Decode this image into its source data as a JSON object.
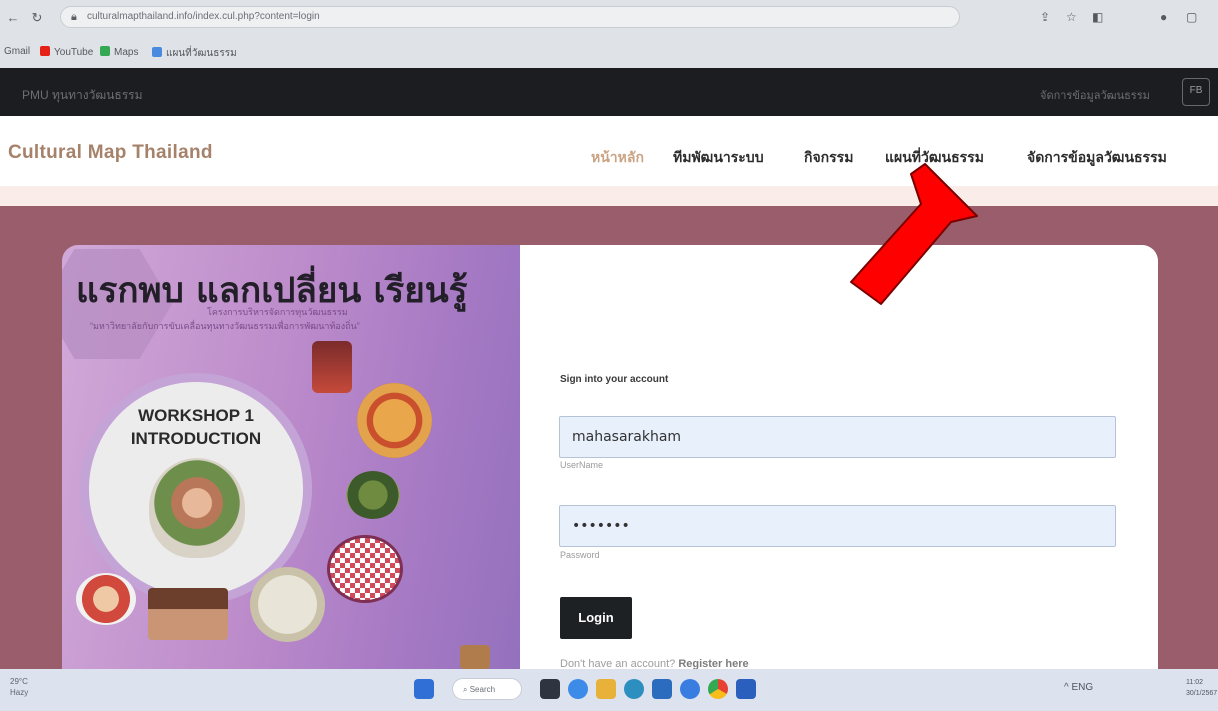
{
  "browser": {
    "url": "culturalmapthailand.info/index.cul.php?content=login",
    "bookmarks": [
      {
        "label": "Gmail",
        "color": "#4285f4"
      },
      {
        "label": "YouTube",
        "color": "#e62117"
      },
      {
        "label": "Maps",
        "color": "#34a853"
      },
      {
        "label": "แผนที่วัฒนธรรม",
        "color": "#4a8be0"
      }
    ],
    "icon_names": [
      "back-icon",
      "reload-icon",
      "lock-icon",
      "share-icon",
      "star-icon",
      "extensions-icon",
      "profile-icon",
      "menu-icon"
    ]
  },
  "sitebar": {
    "left_text": "PMU ทุนทางวัฒนธรรม",
    "right_text": "จัดการข้อมูลวัฒนธรรม",
    "fb_label": "FB"
  },
  "header": {
    "brand": "Cultural Map Thailand",
    "menu": [
      {
        "label": "หน้าหลัก",
        "active": true
      },
      {
        "label": "ทีมพัฒนาระบบ",
        "active": false
      },
      {
        "label": "กิจกรรม",
        "active": false
      },
      {
        "label": "แผนที่วัฒนธรรม",
        "active": false
      },
      {
        "label": "จัดการข้อมูลวัฒนธรรม",
        "active": false
      }
    ]
  },
  "poster": {
    "headline": "แรกพบ แลกเปลี่ยน เรียนรู้",
    "sub1": "โครงการบริหารจัดการทุนวัฒนธรรม",
    "sub2": "“มหาวิทยาลัยกับการขับเคลื่อนทุนทางวัฒนธรรมเพื่อการพัฒนาท้องถิ่น”",
    "workshop_line1": "WORKSHOP 1",
    "workshop_line2": "INTRODUCTION"
  },
  "login": {
    "heading": "Sign into your account",
    "username_value": "mahasarakham",
    "username_label": "UserName",
    "password_value": "•••••••",
    "password_label": "Password",
    "button": "Login",
    "register_prefix": "Don't have an account?",
    "register_link": "Register here"
  },
  "taskbar": {
    "weather_temp": "29°C",
    "weather_text": "Hazy",
    "search_label": "Search",
    "tray_text": "^  ENG",
    "clock_time": "11:02",
    "clock_date": "30/1/2567"
  },
  "colors": {
    "band": "#9a5d6c",
    "brand": "#a6826a",
    "active_menu": "#c9a383",
    "annotation_arrow": "#ff0000"
  }
}
